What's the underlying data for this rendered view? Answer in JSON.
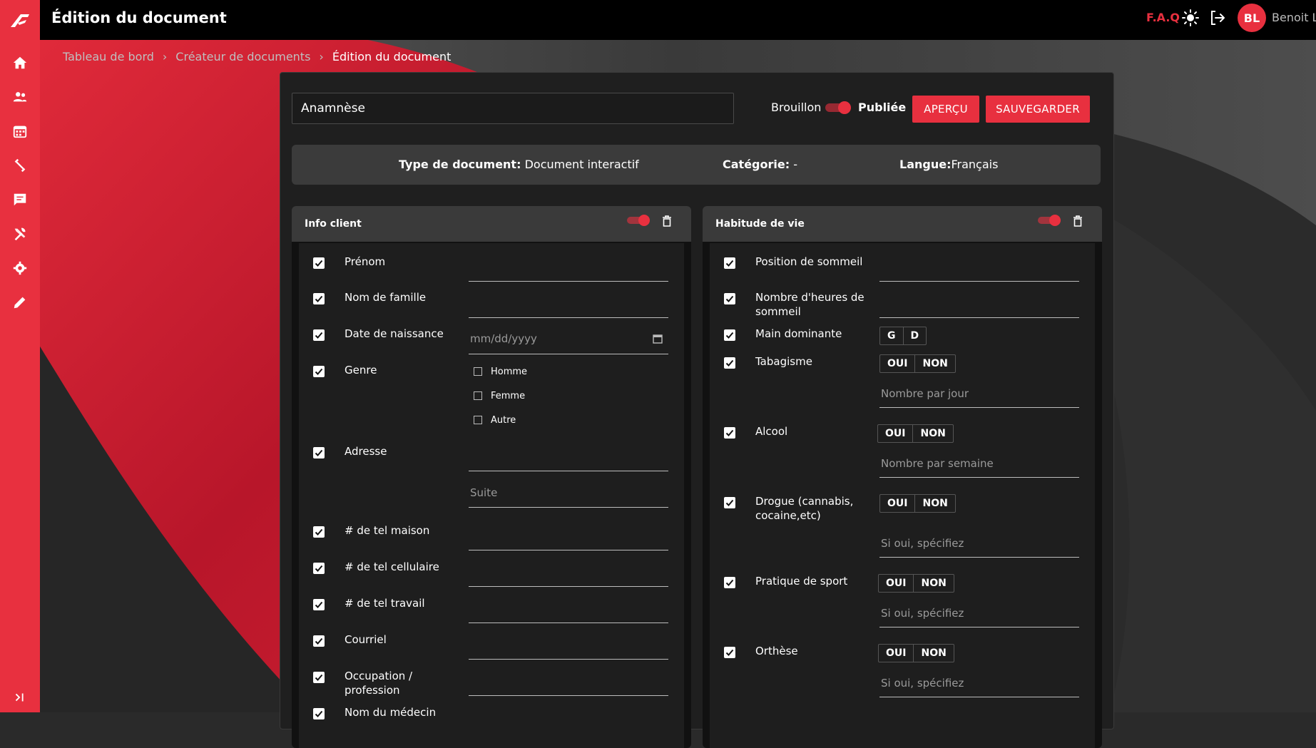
{
  "topbar": {
    "title": "Édition du document",
    "faq": "F.A.Q",
    "avatar_initials": "BL",
    "username": "Benoit L",
    "accent_color": "#e8303f"
  },
  "sidebar": {
    "icons": [
      "home-icon",
      "users-icon",
      "calendar-icon",
      "exercise-icon",
      "messages-icon",
      "tools-icon",
      "settings-icon",
      "pen-icon"
    ],
    "collapse_icon": "expand-sidebar-icon"
  },
  "breadcrumb": {
    "items": [
      "Tableau de bord",
      "Créateur de documents",
      "Édition du document"
    ],
    "separator": "›"
  },
  "editor": {
    "doc_title": "Anamnèse",
    "draft_label": "Brouillon",
    "published_label": "Publiée",
    "published_on": true,
    "preview_button": "APERÇU",
    "save_button": "SAUVEGARDER"
  },
  "info": {
    "type_key": "Type de document:",
    "type_value": "Document interactif",
    "category_key": "Catégorie:",
    "category_value": "-",
    "language_key": "Langue:",
    "language_value": "Français"
  },
  "left_card": {
    "title": "Info client",
    "enabled": true,
    "fields": [
      {
        "label": "Prénom",
        "checked": true
      },
      {
        "label": "Nom de famille",
        "checked": true
      },
      {
        "label": "Date de naissance",
        "checked": true,
        "placeholder": "mm/dd/yyyy"
      },
      {
        "label": "Genre",
        "checked": true,
        "options": [
          "Homme",
          "Femme",
          "Autre"
        ]
      },
      {
        "label": "Adresse",
        "checked": true,
        "placeholder2": "Suite"
      },
      {
        "label": "# de tel maison",
        "checked": true
      },
      {
        "label": "# de tel cellulaire",
        "checked": true
      },
      {
        "label": "# de tel travail",
        "checked": true
      },
      {
        "label": "Courriel",
        "checked": true
      },
      {
        "label": "Occupation / profession",
        "checked": true
      },
      {
        "label": "Nom du médecin",
        "checked": true
      }
    ]
  },
  "right_card": {
    "title": "Habitude de vie",
    "enabled": true,
    "fields": [
      {
        "label": "Position de sommeil",
        "checked": true
      },
      {
        "label": "Nombre d'heures de sommeil",
        "checked": true
      },
      {
        "label": "Main dominante",
        "checked": true,
        "choices": [
          "G",
          "D"
        ]
      },
      {
        "label": "Tabagisme",
        "checked": true,
        "choices": [
          "OUI",
          "NON"
        ],
        "placeholder": "Nombre par jour"
      },
      {
        "label": "Alcool",
        "checked": true,
        "choices": [
          "OUI",
          "NON"
        ],
        "placeholder": "Nombre par semaine"
      },
      {
        "label": "Drogue (cannabis, cocaine,etc)",
        "checked": true,
        "choices": [
          "OUI",
          "NON"
        ],
        "placeholder": "Si oui, spécifiez"
      },
      {
        "label": "Pratique de sport",
        "checked": true,
        "choices": [
          "OUI",
          "NON"
        ],
        "placeholder": "Si oui, spécifiez"
      },
      {
        "label": "Orthèse",
        "checked": true,
        "choices": [
          "OUI",
          "NON"
        ],
        "placeholder": "Si oui, spécifiez"
      }
    ]
  }
}
